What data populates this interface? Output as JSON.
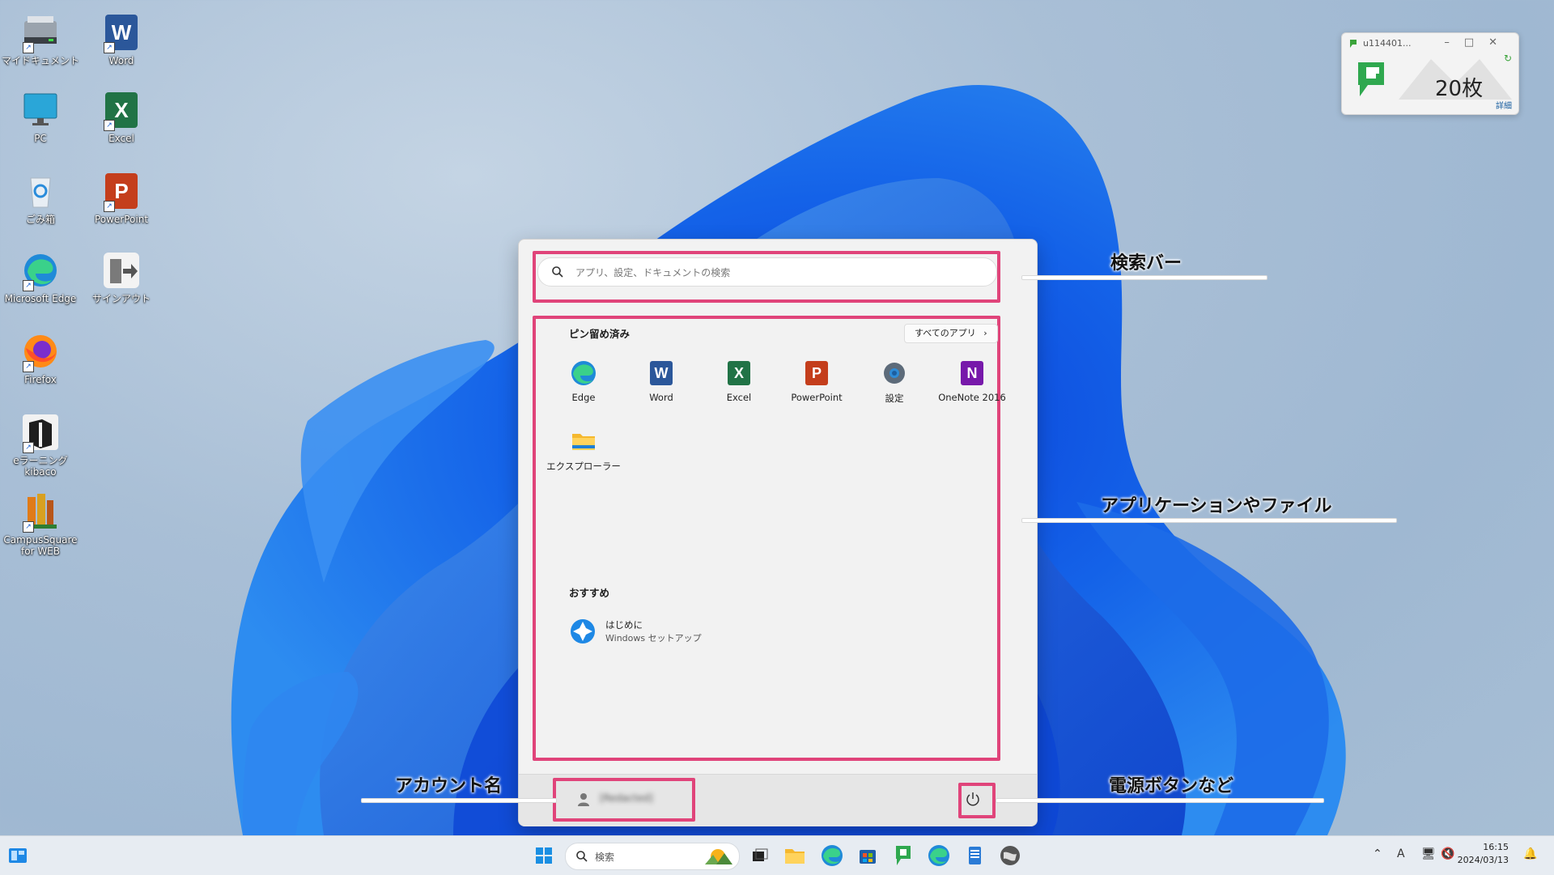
{
  "desktop": {
    "icons": [
      {
        "label": "マイドキュメント"
      },
      {
        "label": "Word"
      },
      {
        "label": "PC"
      },
      {
        "label": "Excel"
      },
      {
        "label": "ごみ箱"
      },
      {
        "label": "PowerPoint"
      },
      {
        "label": "Microsoft Edge"
      },
      {
        "label": "サインアウト"
      },
      {
        "label": "Firefox"
      },
      {
        "label": "eラーニングkibaco"
      },
      {
        "label": "CampusSquare for WEB"
      }
    ]
  },
  "widget": {
    "title": "u114401...",
    "count": "20枚",
    "detail": "詳細"
  },
  "start_menu": {
    "search_placeholder": "アプリ、設定、ドキュメントの検索",
    "pinned_title": "ピン留め済み",
    "all_apps_label": "すべてのアプリ",
    "pinned": [
      {
        "label": "Edge",
        "icon": "edge-icon"
      },
      {
        "label": "Word",
        "icon": "word-icon"
      },
      {
        "label": "Excel",
        "icon": "excel-icon"
      },
      {
        "label": "PowerPoint",
        "icon": "powerpoint-icon"
      },
      {
        "label": "設定",
        "icon": "settings-gear-icon"
      },
      {
        "label": "OneNote 2016",
        "icon": "onenote-icon"
      },
      {
        "label": "エクスプローラー",
        "icon": "folder-icon"
      }
    ],
    "recommended_title": "おすすめ",
    "recommended": [
      {
        "title": "はじめに",
        "subtitle": "Windows セットアップ"
      }
    ],
    "account_name": "[Redacted]"
  },
  "callouts": {
    "search_bar": "検索バー",
    "apps_files": "アプリケーションやファイル",
    "account": "アカウント名",
    "power": "電源ボタンなど"
  },
  "taskbar": {
    "search_label": "検索",
    "time": "16:15",
    "date": "2024/03/13",
    "ime": "A"
  },
  "colors": {
    "highlight": "#e0447a",
    "word": "#2b579a",
    "excel": "#217346",
    "powerpoint": "#c43e1c",
    "onenote": "#7719aa"
  }
}
